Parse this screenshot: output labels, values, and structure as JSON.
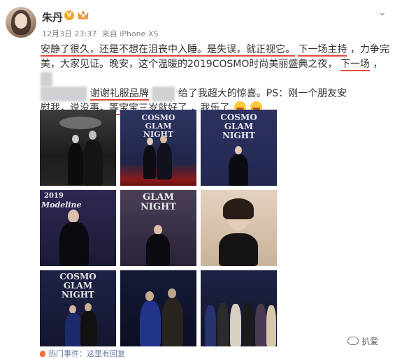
{
  "post": {
    "author": "朱丹",
    "verified_badge": "V",
    "meta": {
      "date": "12月3日 23:37",
      "via": "来自 iPhone XS"
    },
    "text": {
      "l1_a": "安静了很久，还是不想在沮丧中入睡。是失误，就正视它。",
      "l1_b": "下一场主持",
      "l1_c": "，力争完",
      "l2_a": "美，大家见证。晚安，这个温暖的2019COSMO时尚美丽盛典之夜，",
      "l2_b": "下一场",
      "l2_c": "，",
      "l3_a": "谢谢礼服品牌",
      "l3_b": "给了我超大的惊喜。PS：刚一个朋友安",
      "l4_a": "慰我，说没事，等宝宝三岁就好了",
      "l4_b": "，我乐了"
    },
    "photos": [
      {
        "alt": "photo-1"
      },
      {
        "alt": "photo-2"
      },
      {
        "alt": "photo-3"
      },
      {
        "alt": "photo-4"
      },
      {
        "alt": "photo-5"
      },
      {
        "alt": "photo-6"
      },
      {
        "alt": "photo-7"
      },
      {
        "alt": "photo-8"
      },
      {
        "alt": "photo-9"
      }
    ],
    "backdrop_text": {
      "cosmo": "COSMO",
      "glam": "GLAM",
      "night": "NIGHT",
      "year": "2019",
      "magazine": "Modeline"
    },
    "footer": "热门事件：这里有回复"
  },
  "watermark": "扒爱",
  "colors": {
    "underline": "#e8473a",
    "name": "#333333",
    "meta": "#808080",
    "badge": "#f5a623"
  },
  "icons": {
    "chevron": "chevron-down-icon",
    "verified": "verified-badge-icon",
    "crown": "crown-icon"
  }
}
